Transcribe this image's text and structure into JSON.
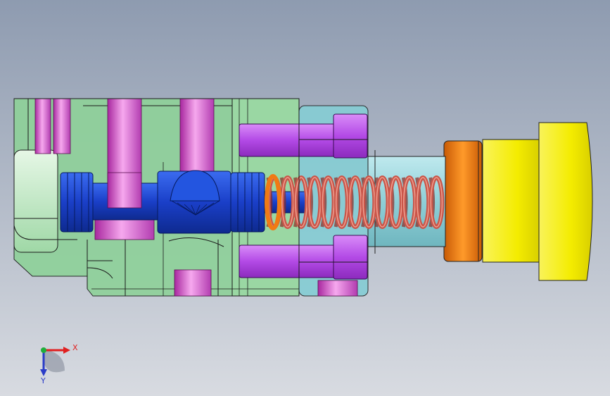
{
  "colors": {
    "bg_top": "#8e9bb0",
    "bg_bottom": "#d8dbe1",
    "body_green": "#8fd19a",
    "body_green_light": "#b9e7c0",
    "spool_blue": "#1f4bd6",
    "channel_magenta": "#d24fd6",
    "bolt_violet": "#c15cf0",
    "sleeve_cyan": "#8ccfd6",
    "spring_red": "#c9564a",
    "nut_orange": "#f07a14",
    "knob_yellow": "#f5ef00",
    "axis_x": "#e02020",
    "axis_y": "#2a3cc8",
    "axis_z": "#1fae3a"
  },
  "axes": {
    "x_label": "X",
    "y_label": "Y"
  }
}
